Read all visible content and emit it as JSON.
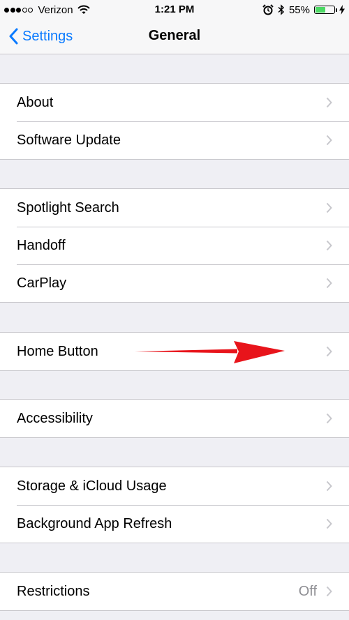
{
  "status_bar": {
    "carrier": "Verizon",
    "time": "1:21 PM",
    "battery_percent": "55%",
    "battery_level": 0.55,
    "signal_bars_filled": 3,
    "signal_bars_total": 5
  },
  "nav": {
    "back_label": "Settings",
    "title": "General"
  },
  "groups": [
    {
      "items": [
        {
          "label": "About"
        },
        {
          "label": "Software Update"
        }
      ]
    },
    {
      "items": [
        {
          "label": "Spotlight Search"
        },
        {
          "label": "Handoff"
        },
        {
          "label": "CarPlay"
        }
      ]
    },
    {
      "items": [
        {
          "label": "Home Button"
        }
      ]
    },
    {
      "items": [
        {
          "label": "Accessibility"
        }
      ]
    },
    {
      "items": [
        {
          "label": "Storage & iCloud Usage"
        },
        {
          "label": "Background App Refresh"
        }
      ]
    },
    {
      "items": [
        {
          "label": "Restrictions",
          "value": "Off"
        }
      ]
    }
  ],
  "colors": {
    "accent": "#0a7aff",
    "background": "#efeff4",
    "separator": "#c8c7cc",
    "chevron": "#c7c7cc",
    "secondary_text": "#8e8e93",
    "battery": "#4cd964",
    "annotation_arrow": "#e8141b"
  },
  "icons": [
    "wifi-icon",
    "alarm-icon",
    "bluetooth-icon",
    "battery-icon",
    "charging-bolt-icon",
    "back-chevron-icon",
    "chevron-right-icon"
  ]
}
